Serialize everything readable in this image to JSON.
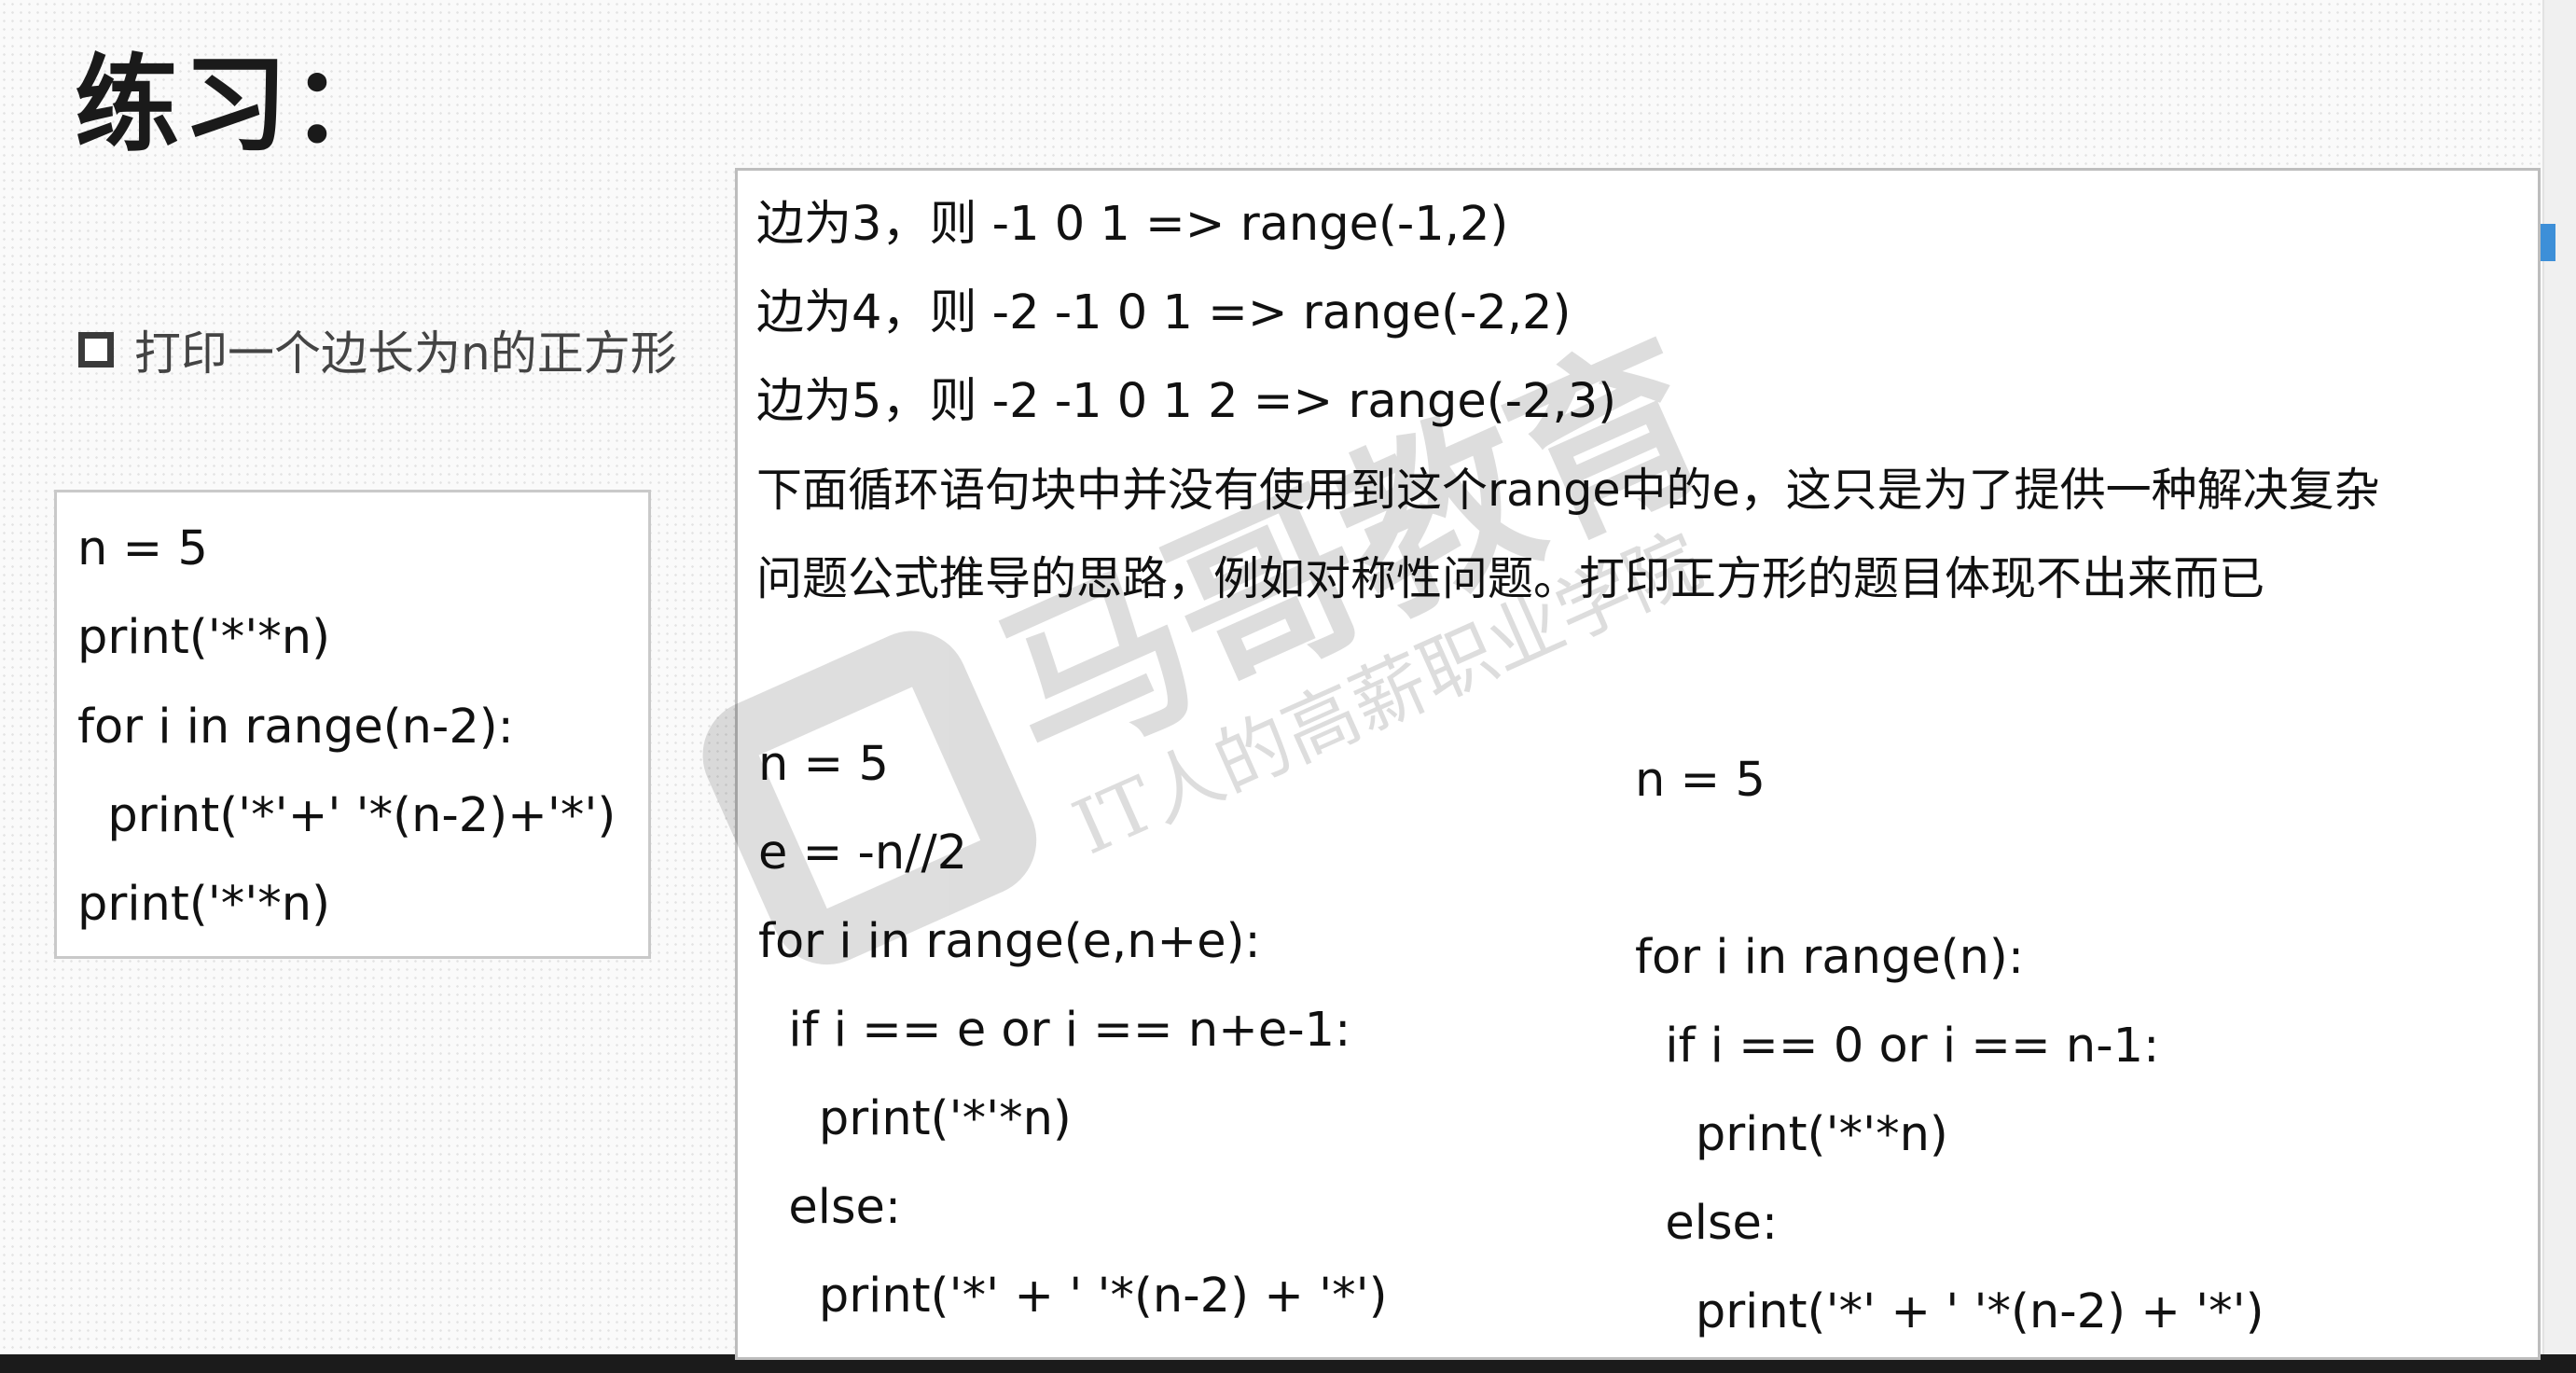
{
  "slide": {
    "title": "练习：",
    "bullet_text": "打印一个边长为n的正方形",
    "left_code": [
      "n = 5",
      "print('*'*n)",
      "for i in range(n-2):",
      "  print('*'+' '*(n-2)+'*')",
      "print('*'*n)"
    ]
  },
  "popup": {
    "notes": [
      "边为3，则 -1 0 1 => range(-1,2)",
      "边为4，则 -2 -1 0 1 => range(-2,2)",
      "边为5，则 -2 -1 0 1 2 => range(-2,3)",
      "下面循环语句块中并没有使用到这个range中的e，这只是为了提供一种解决复杂",
      "问题公式推导的思路，例如对称性问题。打印正方形的题目体现不出来而已"
    ],
    "code_left": [
      "n = 5",
      "e = -n//2",
      "for i in range(e,n+e):",
      "  if i == e or i == n+e-1:",
      "    print('*'*n)",
      "  else:",
      "    print('*' + ' '*(n-2) + '*')"
    ],
    "code_right": [
      "n = 5",
      "",
      "for i in range(n):",
      "  if i == 0 or i == n-1:",
      "    print('*'*n)",
      "  else:",
      "    print('*' + ' '*(n-2) + '*')"
    ]
  },
  "watermark": {
    "brand": "马哥教育",
    "slogan": "IT人的高薪职业学院"
  },
  "colors": {
    "background": "#fafafa",
    "bottom_bar": "#1b1b1b",
    "scroll_thumb": "#3d8fd8"
  }
}
